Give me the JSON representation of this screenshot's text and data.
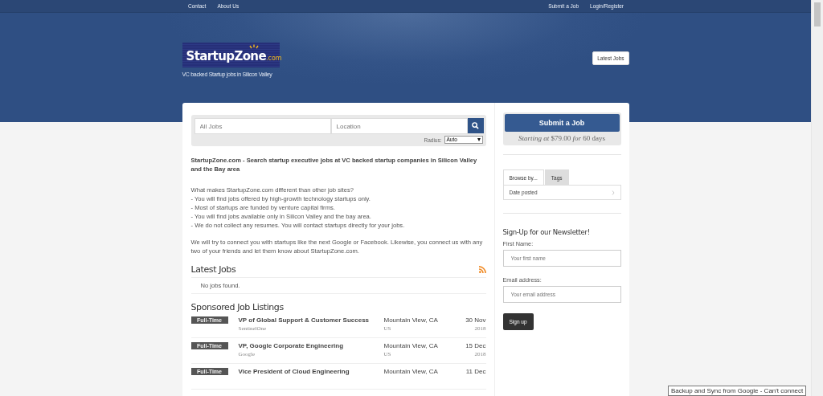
{
  "nav": {
    "left": [
      "Contact",
      "About Us"
    ],
    "right": [
      "Submit a Job",
      "Login/Register"
    ]
  },
  "header": {
    "logo": {
      "text": "StartupZone",
      "suffix": ".com"
    },
    "tagline": "VC backed Startup jobs in Silicon Valley",
    "button": "Latest Jobs"
  },
  "search": {
    "what_placeholder": "All Jobs",
    "where_placeholder": "Location",
    "radius_label": "Radius:",
    "radius_value": "Auto"
  },
  "intro": {
    "headline": "StartupZone.com - Search startup executive jobs at VC backed startup companies in Silicon Valley and the Bay area",
    "lines": [
      "What makes StartupZone.com different than other job sites?",
      "- You will find jobs offered by high-growth technology startups only.",
      "- Most of startups are funded by venture capital firms.",
      "- You will find jobs available only in Silicon Valley and the bay area.",
      "- We do not collect any resumes. You will contact startups directly for your jobs."
    ],
    "closing": "We will try to connect you with startups like the next Google or Facebook. Likewise, you connect us with any two of your friends and let them know about StartupZone.com."
  },
  "latest_jobs": {
    "title": "Latest Jobs",
    "empty": "No jobs found."
  },
  "sponsored": {
    "title": "Sponsored Job Listings",
    "jobs": [
      {
        "type": "Full-Time",
        "title": "VP of Global Support & Customer Success",
        "company": "SentinelOne",
        "location": "Mountain View, CA",
        "country": "US",
        "date": "30 Nov",
        "year": "2018"
      },
      {
        "type": "Full-Time",
        "title": "VP, Google Corporate Engineering",
        "company": "Google",
        "location": "Mountain View, CA",
        "country": "US",
        "date": "15 Dec",
        "year": "2018"
      },
      {
        "type": "Full-Time",
        "title": "Vice President of Cloud Engineering",
        "location": "Mountain View, CA",
        "date": "11 Dec"
      }
    ]
  },
  "sidebar": {
    "submit_button": "Submit a Job",
    "price": "*Starting at* $79.00 *for* 60 days",
    "tabs": [
      {
        "label": "Browse by...",
        "selected": true
      },
      {
        "label": "Tags",
        "selected": false
      }
    ],
    "browse_items": [
      "Date posted"
    ],
    "newsletter": {
      "title": "Sign-Up for our Newsletter!",
      "fields": [
        {
          "label": "First Name:",
          "placeholder": "Your first name"
        },
        {
          "label": "Email address:",
          "placeholder": "Your email address"
        }
      ],
      "button": "Sign up"
    }
  },
  "tooltip": "Backup and Sync from Google - Can't connect"
}
